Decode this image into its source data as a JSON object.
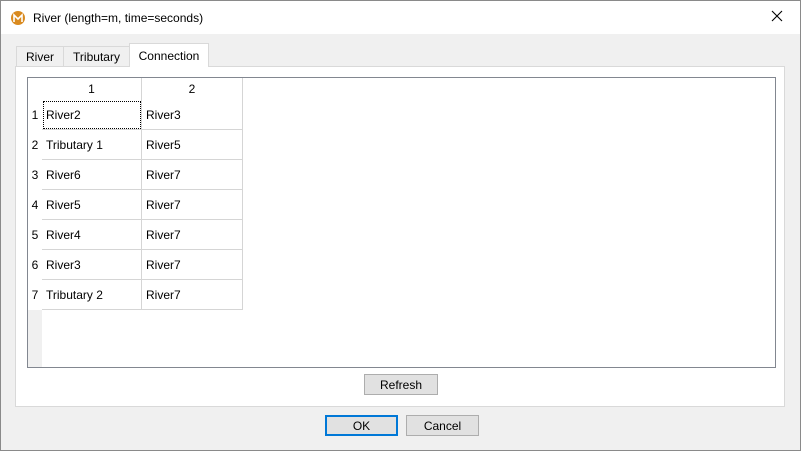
{
  "window": {
    "title": "River (length=m, time=seconds)"
  },
  "tabs": [
    {
      "label": "River"
    },
    {
      "label": "Tributary"
    },
    {
      "label": "Connection"
    }
  ],
  "grid": {
    "columns": [
      "1",
      "2"
    ],
    "rows": [
      {
        "num": "1",
        "c1": "River2",
        "c2": "River3"
      },
      {
        "num": "2",
        "c1": "Tributary 1",
        "c2": "River5"
      },
      {
        "num": "3",
        "c1": "River6",
        "c2": "River7"
      },
      {
        "num": "4",
        "c1": "River5",
        "c2": "River7"
      },
      {
        "num": "5",
        "c1": "River4",
        "c2": "River7"
      },
      {
        "num": "6",
        "c1": "River3",
        "c2": "River7"
      },
      {
        "num": "7",
        "c1": "Tributary 2",
        "c2": "River7"
      }
    ]
  },
  "buttons": {
    "refresh": "Refresh",
    "ok": "OK",
    "cancel": "Cancel"
  },
  "colors": {
    "accent": "#0078d7",
    "app_icon": "#d98a1f"
  }
}
